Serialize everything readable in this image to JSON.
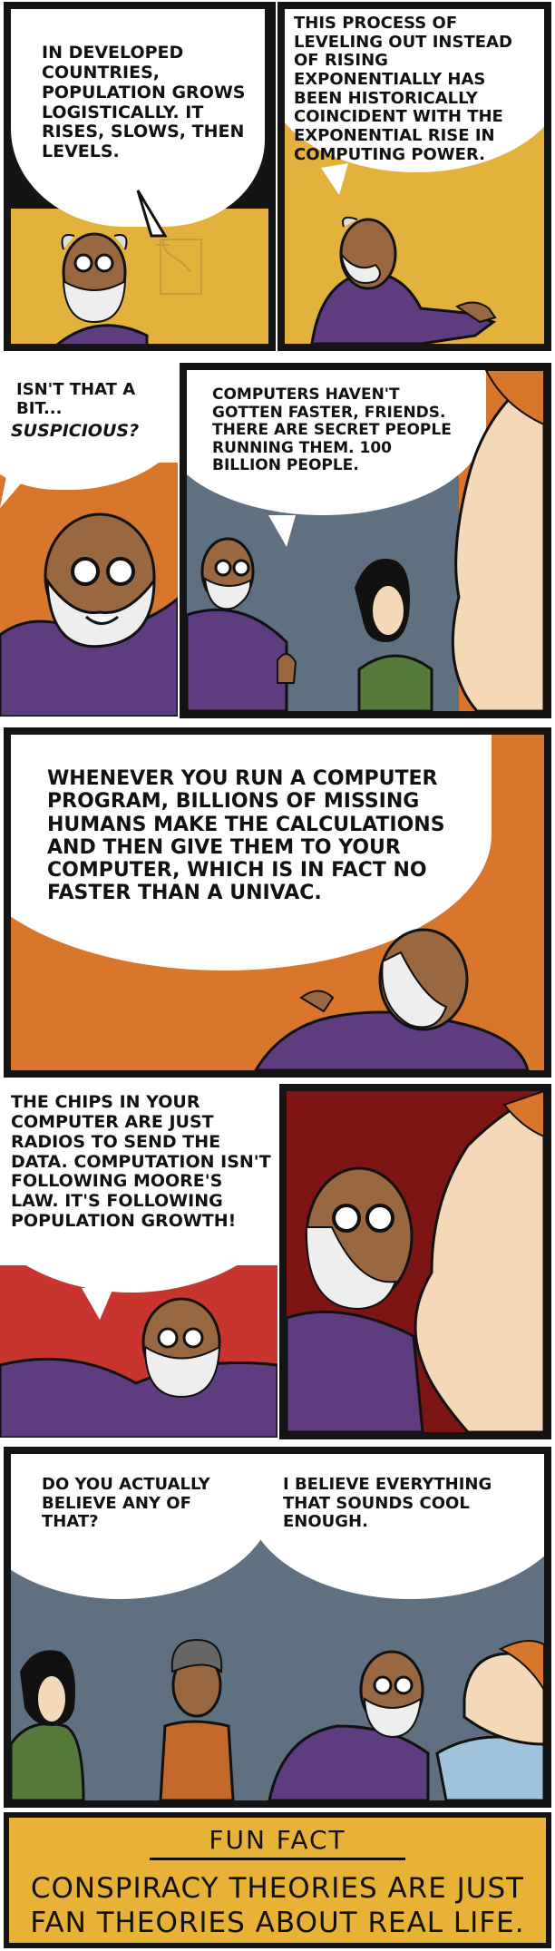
{
  "colors": {
    "frame": "#141414",
    "mustard": "#e2b23d",
    "orange": "#d8772c",
    "red": "#c8342e",
    "slate": "#5f7080",
    "purple": "#5d3d7f",
    "green": "#56793c",
    "skin_dark": "#9a6840",
    "skin_light": "#f4d9b8"
  },
  "panels": [
    {
      "id": 1,
      "caption": "In developed countries, population grows logistically. It rises, slows, then levels."
    },
    {
      "id": 2,
      "caption": "This process of leveling out instead of rising exponentially has been historically coincident with the exponential rise in computing power."
    },
    {
      "id": 3,
      "caption_line1": "Isn't that a bit...",
      "caption_line2": "suspicious?"
    },
    {
      "id": 4,
      "caption": "Computers haven't gotten faster, friends. There are secret people running them. 100 billion people."
    },
    {
      "id": 5,
      "caption": "Whenever you run a computer program, billions of missing humans make the calculations and then give them to your computer, which is in fact no faster than a UNIVAC."
    },
    {
      "id": 6,
      "caption": "The chips in your computer are just radios to send the data. Computation isn't following Moore's law. It's following population growth!"
    },
    {
      "id": 7,
      "caption_left": "Do you actually believe any of that?",
      "caption_right": "I believe everything that sounds cool enough."
    }
  ],
  "fun_fact": {
    "title": "FUN FACT",
    "body": "CONSPIRACY THEORIES ARE JUST FAN THEORIES ABOUT REAL LIFE."
  }
}
